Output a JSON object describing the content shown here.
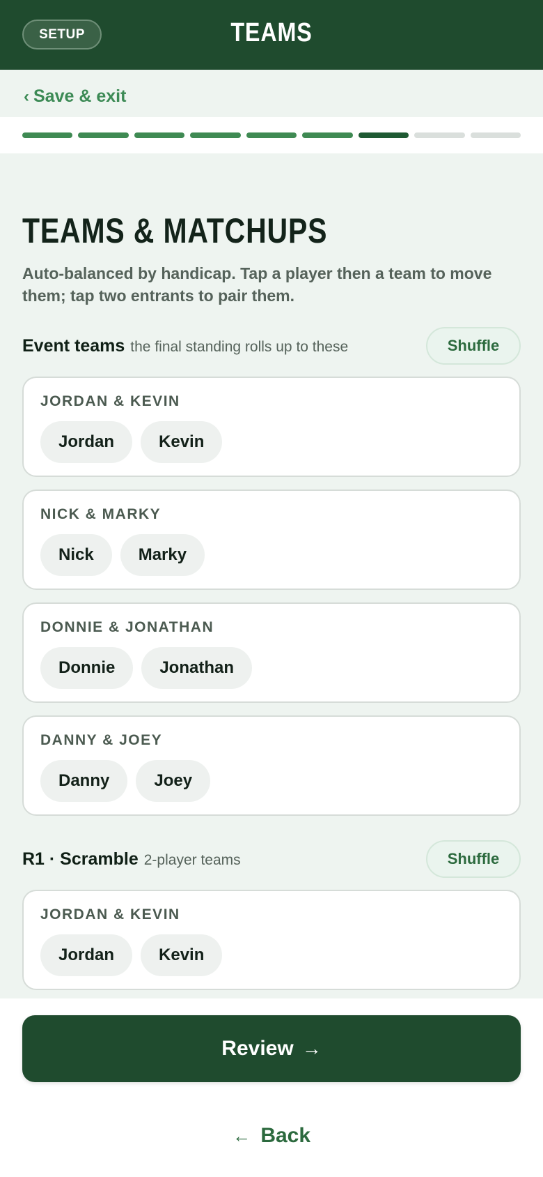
{
  "header": {
    "setup_label": "SETUP",
    "title": "TEAMS"
  },
  "nav": {
    "back_chevron": "‹",
    "save_exit_label": "Save & exit"
  },
  "progress": {
    "total_steps": 9,
    "completed_steps": 6,
    "current_step": 7
  },
  "page": {
    "title": "TEAMS & MATCHUPS",
    "description": "Auto-balanced by handicap. Tap a player then a team to move them; tap two entrants to pair them."
  },
  "event_teams": {
    "title": "Event teams",
    "note": "the final standing rolls up to these",
    "shuffle_label": "Shuffle",
    "teams": [
      {
        "name": "JORDAN & KEVIN",
        "players": [
          "Jordan",
          "Kevin"
        ]
      },
      {
        "name": "NICK & MARKY",
        "players": [
          "Nick",
          "Marky"
        ]
      },
      {
        "name": "DONNIE & JONATHAN",
        "players": [
          "Donnie",
          "Jonathan"
        ]
      },
      {
        "name": "DANNY & JOEY",
        "players": [
          "Danny",
          "Joey"
        ]
      }
    ]
  },
  "round1": {
    "title": "R1 · Scramble",
    "note": "2-player teams",
    "shuffle_label": "Shuffle",
    "teams": [
      {
        "name": "JORDAN & KEVIN",
        "players": [
          "Jordan",
          "Kevin"
        ]
      }
    ]
  },
  "footer": {
    "review_label": "Review",
    "review_arrow": "→",
    "back_arrow": "←",
    "back_label": "Back"
  },
  "colors": {
    "brand_dark": "#1f4b2e",
    "accent_green": "#3c8a55",
    "background": "#eef4f0"
  }
}
